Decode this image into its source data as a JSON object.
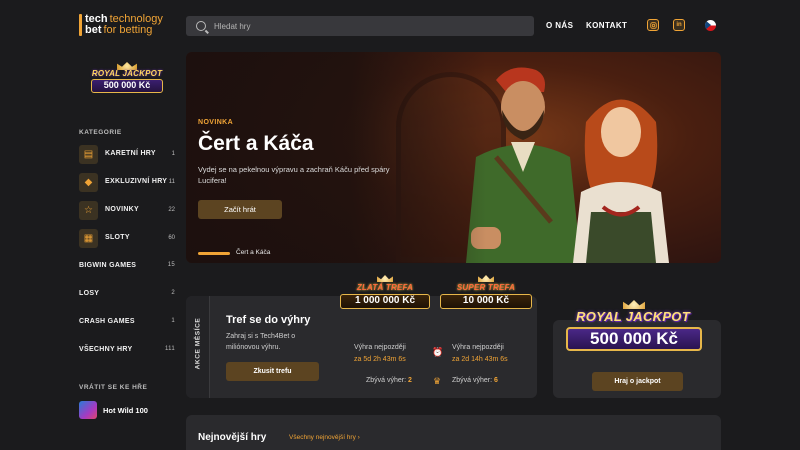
{
  "header": {
    "logo": {
      "word1": "tech",
      "word2": "technology",
      "word3": "bet",
      "word4": "for betting"
    },
    "search": {
      "placeholder": "Hledat hry"
    },
    "nav": {
      "about": "O NÁS",
      "contact": "KONTAKT"
    },
    "social": {
      "instagram_icon": "instagram-icon",
      "linkedin_icon": "linkedin-icon",
      "linkedin_text": "in"
    }
  },
  "sidebar": {
    "jackpot": {
      "title": "ROYAL JACKPOT",
      "value": "500 000 Kč"
    },
    "categories_label": "KATEGORIE",
    "categories": [
      {
        "label": "KARETNÍ HRY",
        "count": "1",
        "icon": "cards-icon"
      },
      {
        "label": "EXKLUZIVNÍ HRY",
        "count": "11",
        "icon": "diamond-icon"
      },
      {
        "label": "NOVINKY",
        "count": "22",
        "icon": "star-icon"
      },
      {
        "label": "SLOTY",
        "count": "60",
        "icon": "slot-icon"
      }
    ],
    "plain_categories": [
      {
        "label": "BIGWIN GAMES",
        "count": "15"
      },
      {
        "label": "LOSY",
        "count": "2"
      },
      {
        "label": "CRASH GAMES",
        "count": "1"
      },
      {
        "label": "VŠECHNY HRY",
        "count": "111"
      }
    ],
    "return_label": "VRÁTIT SE KE HŘE",
    "recent_game": "Hot Wild 100"
  },
  "hero": {
    "tag": "NOVINKA",
    "title": "Čert a Káča",
    "description": "Vydej se na pekelnou výpravu a zachraň Káču před spáry Lucifera!",
    "button": "Začít hrát",
    "slide_label": "Čert a Káča"
  },
  "akce": {
    "side_label": "AKCE MĚSÍCE",
    "title": "Tref se do výhry",
    "description": "Zahraj si s Tech4Bet o miliónovou výhru.",
    "button": "Zkusit trefu",
    "zlata": {
      "name": "ZLATÁ TREFA",
      "value": "1 000 000 Kč",
      "win_label": "Výhra nejpozději",
      "win_time": "za 5d 2h 43m 6s",
      "remaining_label": "Zbývá výher:",
      "remaining": "2"
    },
    "super": {
      "name": "SUPER TREFA",
      "value": "10 000 Kč",
      "win_label": "Výhra nejpozději",
      "win_time": "za 2d 14h 43m 6s",
      "remaining_label": "Zbývá výher:",
      "remaining": "6"
    }
  },
  "royal_jackpot": {
    "title": "ROYAL JACKPOT",
    "value": "500 000 Kč",
    "button": "Hraj o jackpot"
  },
  "newest": {
    "title": "Nejnovější hry",
    "link": "Všechny nejnovější hry ›"
  },
  "colors": {
    "accent": "#f0a436",
    "background": "#1b1b1d",
    "card": "#2a2a2d",
    "button": "#5c4421"
  }
}
